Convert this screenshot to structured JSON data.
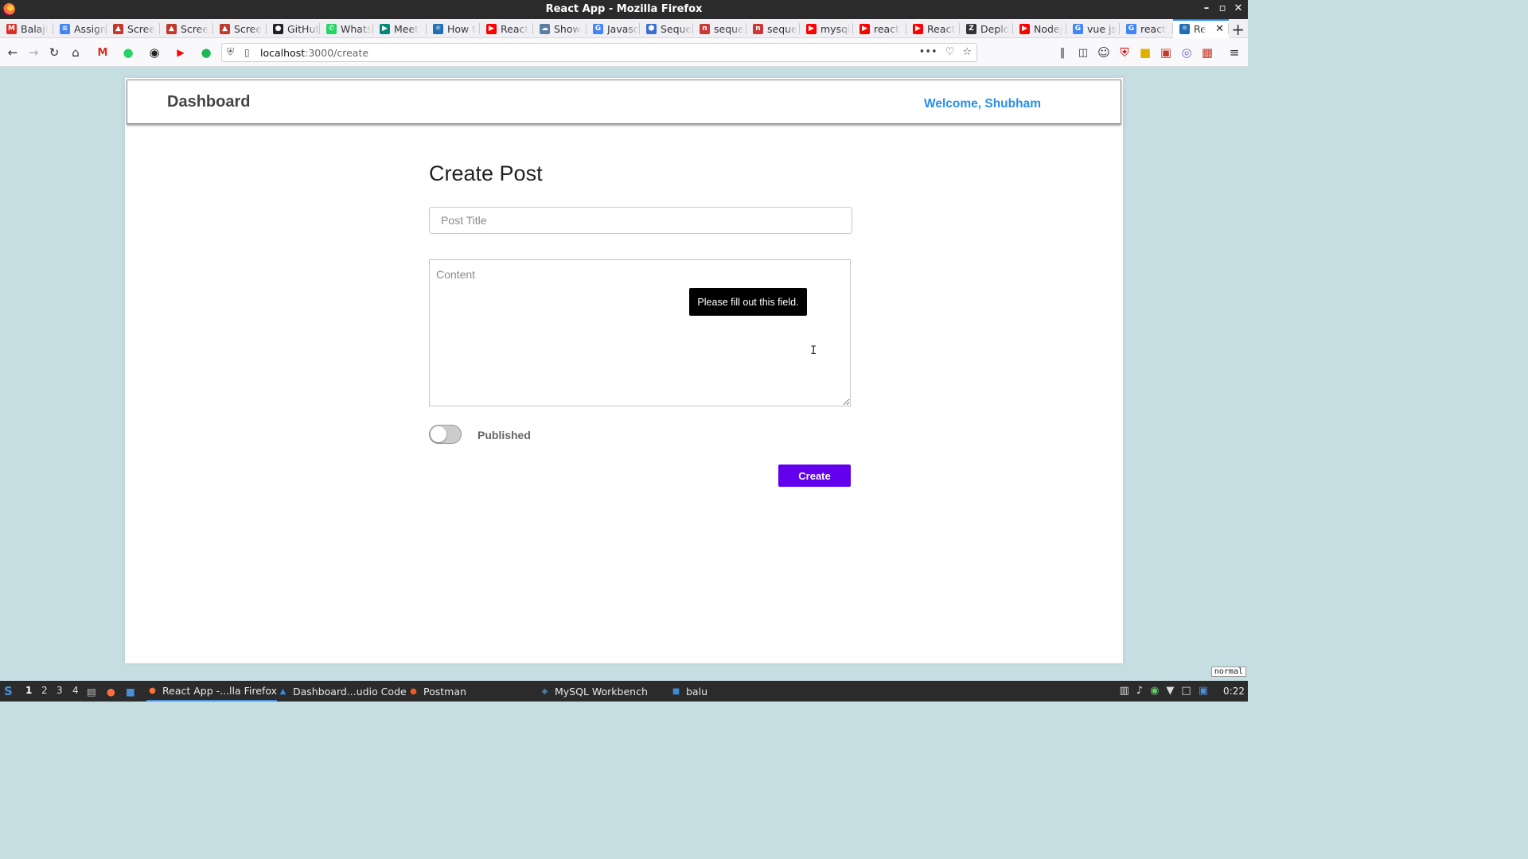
{
  "window": {
    "title": "React App - Mozilla Firefox",
    "controls": [
      "–",
      "▫",
      "✕"
    ]
  },
  "tabs": [
    {
      "label": "Balaji",
      "icon": "gmail-icon",
      "color": "#d93025",
      "glyph": "M"
    },
    {
      "label": "Assign",
      "icon": "docs-icon",
      "color": "#4285f4",
      "glyph": "≡"
    },
    {
      "label": "Scree",
      "icon": "image-icon",
      "color": "#c0392b",
      "glyph": "▲"
    },
    {
      "label": "Scree",
      "icon": "image-icon",
      "color": "#c0392b",
      "glyph": "▲"
    },
    {
      "label": "Scree",
      "icon": "image-icon",
      "color": "#c0392b",
      "glyph": "▲"
    },
    {
      "label": "GitHub",
      "icon": "github-icon",
      "color": "#222222",
      "glyph": "●"
    },
    {
      "label": "Whats",
      "icon": "whatsapp-icon",
      "color": "#25d366",
      "glyph": "✆"
    },
    {
      "label": "Meet",
      "icon": "meet-icon",
      "color": "#00897b",
      "glyph": "▶"
    },
    {
      "label": "How t",
      "icon": "react-icon",
      "color": "#1f6fb2",
      "glyph": "⚛"
    },
    {
      "label": "React",
      "icon": "youtube-icon",
      "color": "#ff0000",
      "glyph": "▶"
    },
    {
      "label": "Show",
      "icon": "cloud-icon",
      "color": "#5b7fa3",
      "glyph": "☁"
    },
    {
      "label": "Javasc",
      "icon": "google-icon",
      "color": "#4285f4",
      "glyph": "G"
    },
    {
      "label": "Seque",
      "icon": "sequelize-icon",
      "color": "#3b6fd1",
      "glyph": "⬢"
    },
    {
      "label": "seque",
      "icon": "npm-icon",
      "color": "#cb3837",
      "glyph": "n"
    },
    {
      "label": "seque",
      "icon": "npm-icon",
      "color": "#cb3837",
      "glyph": "n"
    },
    {
      "label": "mysql",
      "icon": "youtube-icon",
      "color": "#ff0000",
      "glyph": "▶"
    },
    {
      "label": "react",
      "icon": "youtube-icon",
      "color": "#ff0000",
      "glyph": "▶"
    },
    {
      "label": "React",
      "icon": "youtube-icon",
      "color": "#ff0000",
      "glyph": "▶"
    },
    {
      "label": "Deplo",
      "icon": "deploy-icon",
      "color": "#333333",
      "glyph": "Z"
    },
    {
      "label": "Nodej",
      "icon": "youtube-icon",
      "color": "#ff0000",
      "glyph": "▶"
    },
    {
      "label": "vue js",
      "icon": "google-icon",
      "color": "#4285f4",
      "glyph": "G"
    },
    {
      "label": "react",
      "icon": "google-icon",
      "color": "#4285f4",
      "glyph": "G"
    },
    {
      "label": "Re",
      "icon": "react-icon",
      "color": "#1f6fb2",
      "glyph": "⚛",
      "active": true
    }
  ],
  "toolbar": {
    "url_host": "localhost",
    "url_path": ":3000/create",
    "more": "•••"
  },
  "app": {
    "brand": "Dashboard",
    "welcome": "Welcome, Shubham",
    "form_title": "Create Post",
    "title_placeholder": "Post Title",
    "content_placeholder": "Content",
    "published_label": "Published",
    "published": false,
    "create_button": "Create",
    "validation_tooltip": "Please fill out this field."
  },
  "status_badge": "normal",
  "taskbar": {
    "workspaces": [
      "1",
      "2",
      "3",
      "4"
    ],
    "current_workspace": "1",
    "apps": [
      {
        "label": "React App -...lla Firefox",
        "icon": "firefox-icon",
        "color": "#ff7139",
        "active": true
      },
      {
        "label": "Dashboard...udio Code",
        "icon": "vscode-icon",
        "color": "#2a8ee8"
      },
      {
        "label": "Postman",
        "icon": "postman-icon",
        "color": "#ef5b25"
      },
      {
        "label": "MySQL Workbench",
        "icon": "mysql-workbench-icon",
        "color": "#4479a1"
      },
      {
        "label": "balu",
        "icon": "folder-icon",
        "color": "#3d8ad6"
      }
    ],
    "clock": "0:22"
  }
}
